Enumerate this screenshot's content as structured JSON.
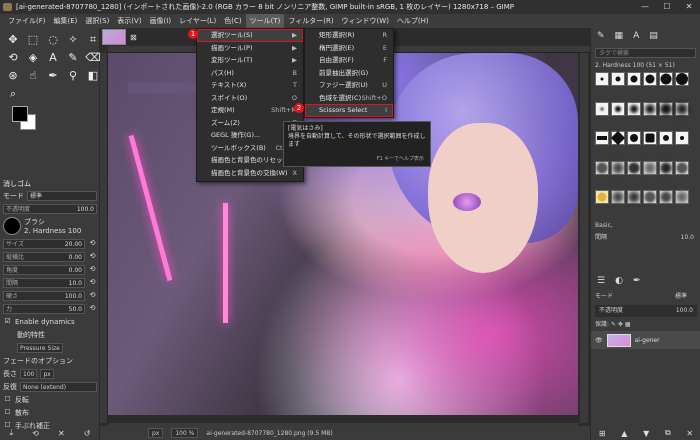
{
  "window": {
    "title": "[ai-generated-8707780_1280] (インポートされた画像)-2.0 (RGB カラー 8 bit ノンリニア整数, GIMP built-in sRGB, 1 枚のレイヤー) 1280x718 – GIMP",
    "minimize": "—",
    "maximize": "☐",
    "close": "✕"
  },
  "menubar": [
    "ファイル(F)",
    "編集(E)",
    "選択(S)",
    "表示(V)",
    "画像(I)",
    "レイヤー(L)",
    "色(C)",
    "ツール(T)",
    "フィルター(R)",
    "ウィンドウ(W)",
    "ヘルプ(H)"
  ],
  "tools_menu": [
    {
      "label": "選択ツール(S)",
      "shortcut": "▶"
    },
    {
      "label": "描画ツール(P)",
      "shortcut": "▶"
    },
    {
      "label": "変形ツール(T)",
      "shortcut": "▶"
    },
    {
      "label": "パス(H)",
      "shortcut": "B"
    },
    {
      "label": "テキスト(X)",
      "shortcut": "T"
    },
    {
      "label": "スポイト(O)",
      "shortcut": "O"
    },
    {
      "label": "定規(M)",
      "shortcut": "Shift+M"
    },
    {
      "label": "ズーム(Z)",
      "shortcut": "Z"
    },
    {
      "label": "GEGL 操作(G)...",
      "shortcut": ""
    },
    {
      "label": "ツールボックス(B)",
      "shortcut": "Ctrl+B"
    },
    {
      "label": "描画色と背景色のリセット(D)",
      "shortcut": "D"
    },
    {
      "label": "描画色と背景色の交換(W)",
      "shortcut": "X"
    }
  ],
  "select_submenu": [
    {
      "label": "矩形選択(R)",
      "shortcut": "R"
    },
    {
      "label": "楕円選択(E)",
      "shortcut": "E"
    },
    {
      "label": "自由選択(F)",
      "shortcut": "F"
    },
    {
      "label": "前景抽出選択(G)",
      "shortcut": ""
    },
    {
      "label": "ファジー選択(U)",
      "shortcut": "U"
    },
    {
      "label": "色域を選択(C)",
      "shortcut": "Shift+O"
    },
    {
      "label": "Scissors Select",
      "shortcut": "I"
    }
  ],
  "badges": {
    "one": "1",
    "two": "2"
  },
  "tooltip": {
    "title": "[電気はさみ]",
    "body": "境界を自動計算して、その形状で選択範囲を作成します",
    "hint": "F1 キーでヘルプ表示"
  },
  "tool_options": {
    "title": "消しゴム",
    "mode_label": "モード",
    "mode_value": "標準",
    "opacity_label": "不透明度",
    "opacity_value": "100.0",
    "brush_label": "ブラシ",
    "brush_name": "2. Hardness 100",
    "size_label": "サイズ",
    "size_value": "20.00",
    "aspect_label": "縦横比",
    "aspect_value": "0.00",
    "angle_label": "角度",
    "angle_value": "0.00",
    "spacing_label": "間隔",
    "spacing_value": "10.0",
    "hardness_label": "硬さ",
    "hardness_value": "100.0",
    "force_label": "力",
    "force_value": "50.0",
    "dynamics_label": "Enable dynamics",
    "dynamics_section": "動的特性",
    "dynamics_value": "Pressure Size",
    "fade_label": "フェードのオプション",
    "fade_length_label": "長さ",
    "fade_length": "100",
    "fade_unit": "px",
    "repeat_label": "反復",
    "repeat_value": "None (extend)",
    "reverse_label": "反転",
    "scatter_label": "散布",
    "smooth_label": "手ぶれ補正"
  },
  "image_tab": {
    "close": "⊠"
  },
  "statusbar": {
    "unit": "px",
    "zoom": "100 %",
    "filename": "ai-generated-8707780_1280.png (9.5 MB)"
  },
  "right_panel": {
    "search_placeholder": "タグで検索",
    "brush_title": "2. Hardness 100 (51 × 51)",
    "preset": "Basic,",
    "spacing_label": "間隔",
    "spacing_value": "10.0",
    "mode_label": "モード",
    "mode_value": "標準",
    "opacity_label": "不透明度",
    "opacity_value": "100.0",
    "lock_label": "保護:",
    "layer_name": "ai-gener"
  }
}
